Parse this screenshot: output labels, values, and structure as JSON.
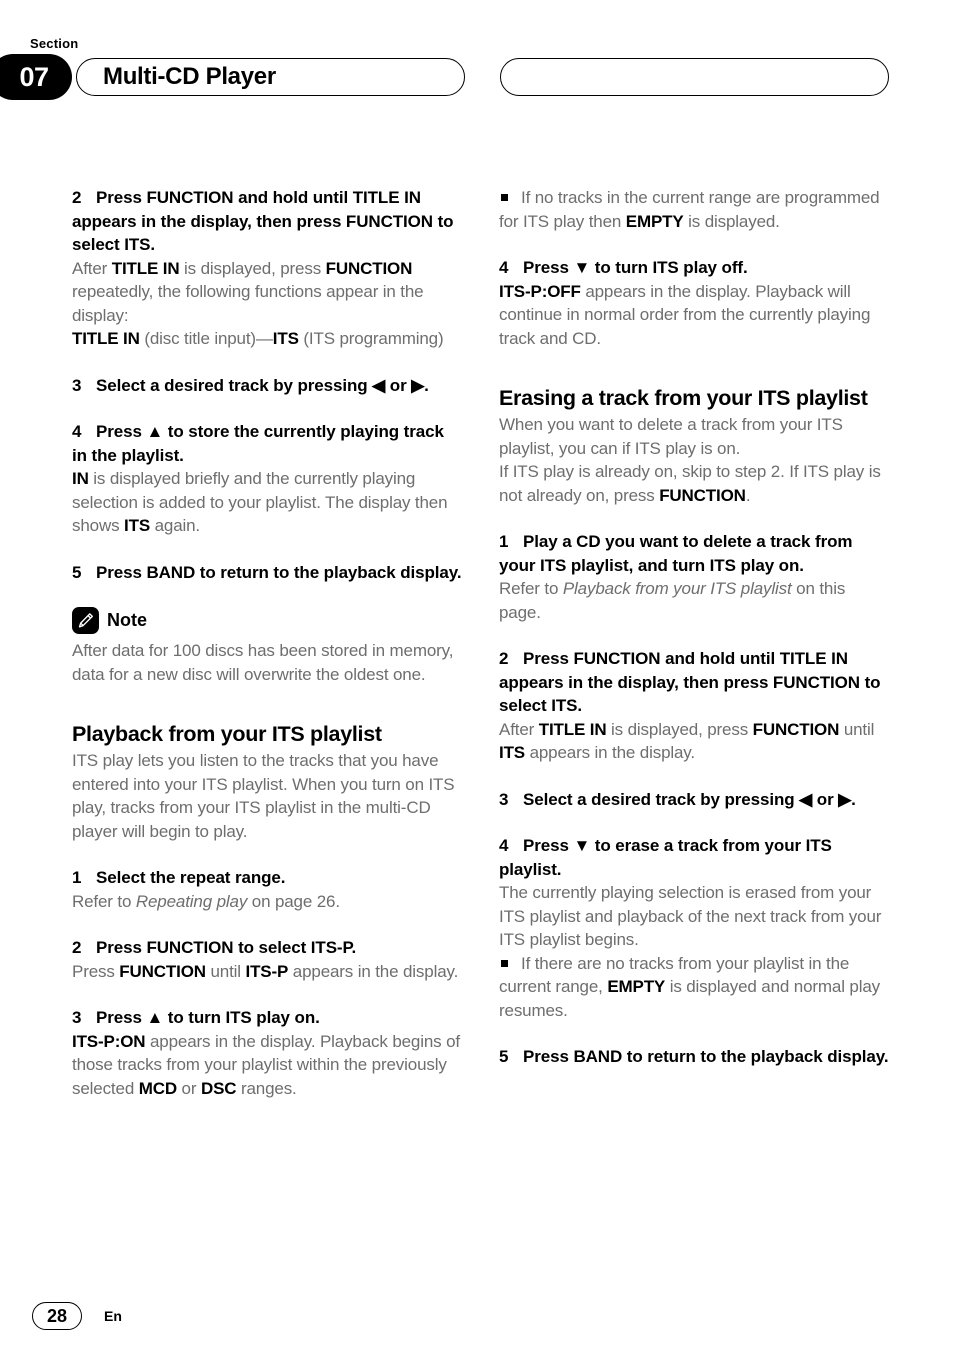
{
  "header": {
    "section_label": "Section",
    "section_number": "07",
    "title": "Multi-CD Player",
    "right_pill_title": ""
  },
  "left_column": {
    "step2": {
      "num": "2",
      "head": "Press FUNCTION and hold until TITLE IN appears in the display, then press FUNCTION to select ITS.",
      "body_line1_a": "After ",
      "body_line1_b": "TITLE IN",
      "body_line1_c": " is displayed, press ",
      "body_line1_d": "FUNCTION",
      "body_line1_e": " repeatedly, the following functions appear in the display:",
      "body_line2_a": "TITLE IN",
      "body_line2_b": " (disc title input)—",
      "body_line2_c": "ITS",
      "body_line2_d": " (ITS programming)"
    },
    "step3": {
      "num": "3",
      "head": "Select a desired track by pressing ◀ or ▶."
    },
    "step4": {
      "num": "4",
      "head": "Press ▲ to store the currently playing track in the playlist.",
      "body_a": "IN",
      "body_b": " is displayed briefly and the currently playing selection is added to your playlist. The display then shows ",
      "body_c": "ITS",
      "body_d": " again."
    },
    "step5": {
      "num": "5",
      "head": "Press BAND to return to the playback display."
    },
    "note": {
      "icon_name": "pencil-icon",
      "title": "Note",
      "body": "After data for 100 discs has been stored in memory, data for a new disc will overwrite the oldest one."
    },
    "heading_playback": "Playback from your ITS playlist",
    "playback_intro": "ITS play lets you listen to the tracks that you have entered into your ITS playlist. When you turn on ITS play, tracks from your ITS playlist in the multi-CD player will begin to play.",
    "pb_step1": {
      "num": "1",
      "head": "Select the repeat range.",
      "body_a": "Refer to ",
      "body_b": "Repeating play",
      "body_c": " on page 26."
    },
    "pb_step2": {
      "num": "2",
      "head": "Press FUNCTION to select ITS-P.",
      "body_a": "Press ",
      "body_b": "FUNCTION",
      "body_c": " until ",
      "body_d": "ITS-P",
      "body_e": " appears in the display."
    },
    "pb_step3": {
      "num": "3",
      "head": "Press ▲ to turn ITS play on.",
      "body_a": "ITS-P:ON",
      "body_b": " appears in the display. Playback begins of those tracks from your playlist within the previously selected ",
      "body_c": "MCD",
      "body_d": " or ",
      "body_e": "DSC",
      "body_f": " ranges."
    }
  },
  "right_column": {
    "bullet1": {
      "a": "If no tracks in the current range are programmed for ITS play then ",
      "b": "EMPTY",
      "c": " is displayed."
    },
    "step4": {
      "num": "4",
      "head": "Press ▼ to turn ITS play off.",
      "body_a": "ITS-P:OFF",
      "body_b": " appears in the display. Playback will continue in normal order from the currently playing track and CD."
    },
    "heading_erasing": "Erasing a track from your ITS playlist",
    "erasing_intro_line1": "When you want to delete a track from your ITS playlist, you can if ITS play is on.",
    "erasing_intro_line2_a": "If ITS play is already on, skip to step 2. If ITS play is not already on, press ",
    "erasing_intro_line2_b": "FUNCTION",
    "erasing_intro_line2_c": ".",
    "er_step1": {
      "num": "1",
      "head": "Play a CD you want to delete a track from your ITS playlist, and turn ITS play on.",
      "body_a": "Refer to ",
      "body_b": "Playback from your ITS playlist",
      "body_c": " on this page."
    },
    "er_step2": {
      "num": "2",
      "head": "Press FUNCTION and hold until TITLE IN appears in the display, then press FUNCTION to select ITS.",
      "body_a": "After ",
      "body_b": "TITLE IN",
      "body_c": " is displayed, press ",
      "body_d": "FUNCTION",
      "body_e": " until ",
      "body_f": "ITS",
      "body_g": " appears in the display."
    },
    "er_step3": {
      "num": "3",
      "head": "Select a desired track by pressing ◀ or ▶."
    },
    "er_step4": {
      "num": "4",
      "head": "Press ▼ to erase a track from your ITS playlist.",
      "body": "The currently playing selection is erased from your ITS playlist and playback of the next track from your ITS playlist begins."
    },
    "bullet2": {
      "a": "If there are no tracks from your playlist in the current range, ",
      "b": "EMPTY",
      "c": " is displayed and normal play resumes."
    },
    "er_step5": {
      "num": "5",
      "head": "Press BAND to return to the playback display."
    }
  },
  "footer": {
    "page_number": "28",
    "language": "En"
  }
}
